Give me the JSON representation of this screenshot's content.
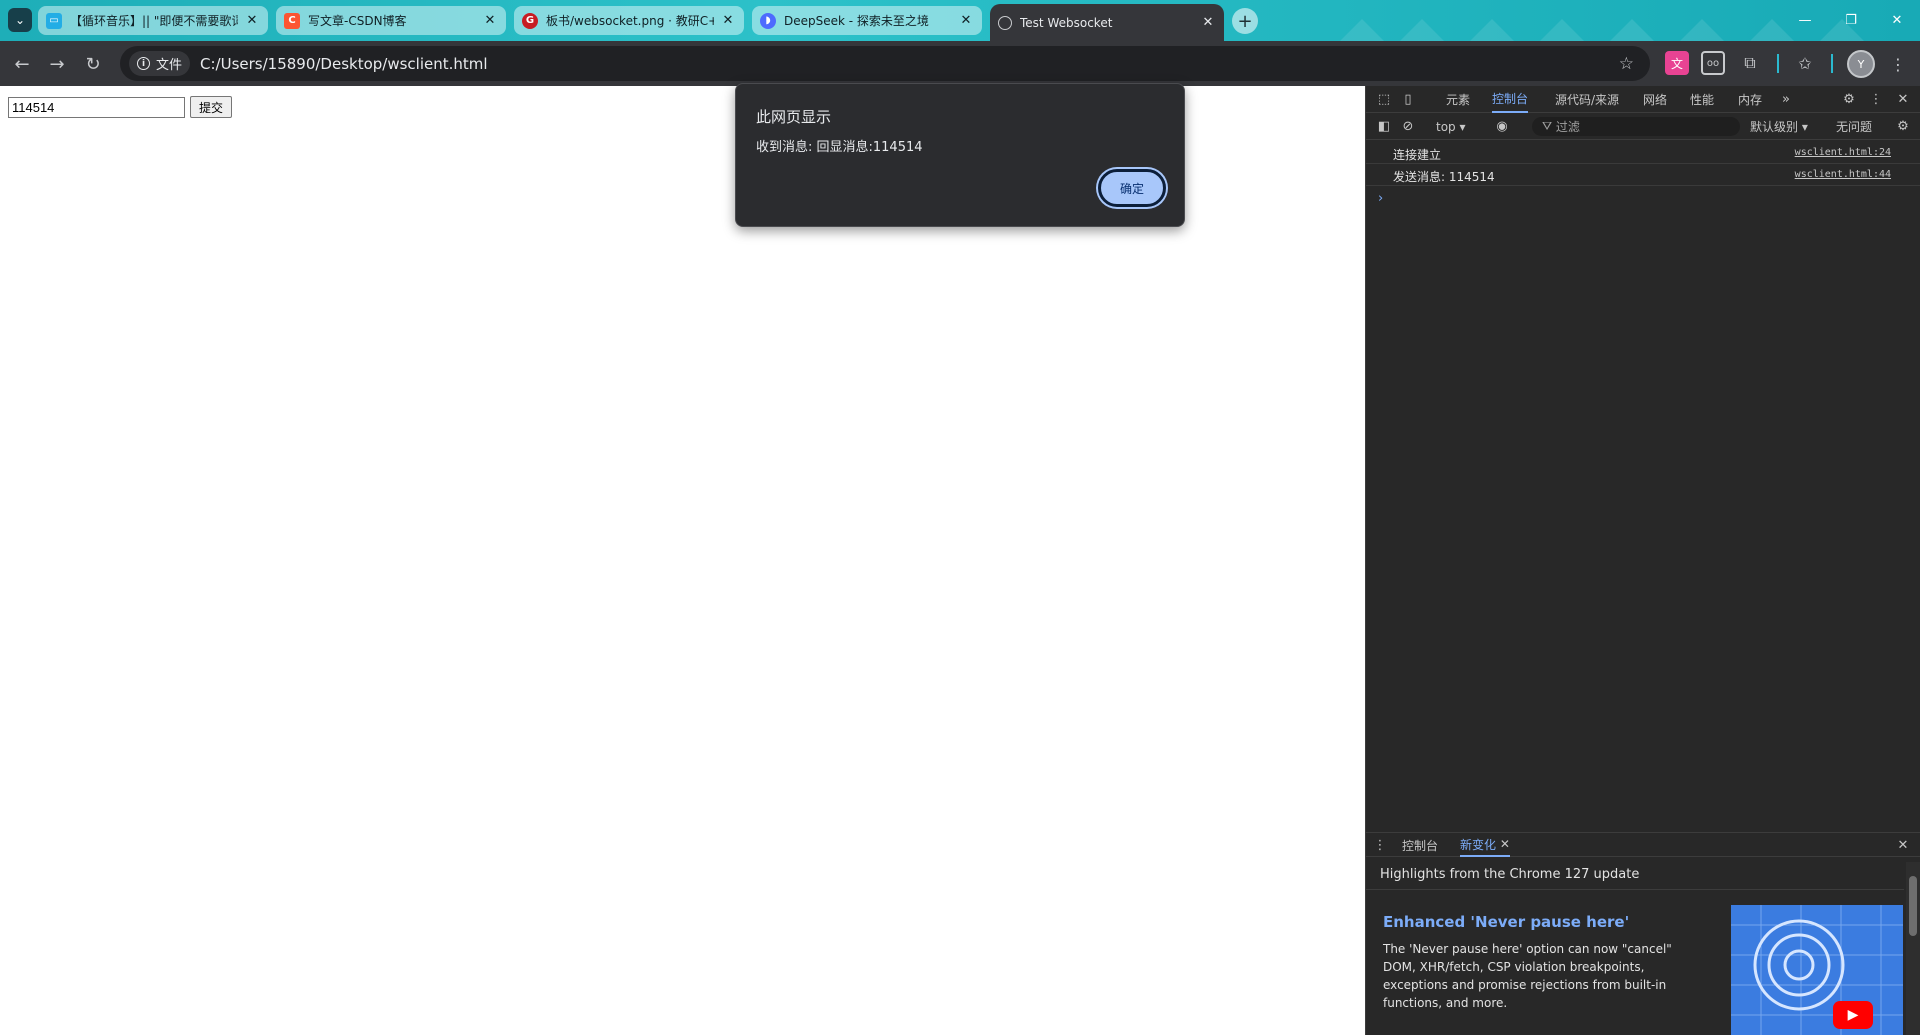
{
  "browser": {
    "tabs": [
      {
        "title": "【循环音乐】|| \"即便不需要歌词",
        "favicon": "bilibili-icon",
        "color": "#23ade5"
      },
      {
        "title": "写文章-CSDN博客",
        "favicon": "csdn-icon",
        "color": "#fc5531"
      },
      {
        "title": "板书/websocket.png · 教研C++",
        "favicon": "gitee-icon",
        "color": "#c71d23"
      },
      {
        "title": "DeepSeek - 探索未至之境",
        "favicon": "deepseek-icon",
        "color": "#4d6bfe"
      },
      {
        "title": "Test Websocket",
        "favicon": "globe-icon",
        "active": true
      }
    ],
    "address_chip": "文件",
    "url": "C:/Users/15890/Desktop/wsclient.html",
    "avatar_letter": "Y"
  },
  "page": {
    "input_value": "114514",
    "submit_label": "提交"
  },
  "alert": {
    "title": "此网页显示",
    "message": "收到消息: 回显消息:114514",
    "ok_label": "确定"
  },
  "devtools": {
    "tabs": [
      "元素",
      "控制台",
      "源代码/来源",
      "网络",
      "性能",
      "内存"
    ],
    "active_tab": "控制台",
    "context": "top",
    "filter_placeholder": "过滤",
    "levels": "默认级别",
    "issues": "无问题",
    "logs": [
      {
        "message": "连接建立",
        "source": "wsclient.html:24"
      },
      {
        "message": "发送消息: 114514",
        "source": "wsclient.html:44"
      }
    ],
    "drawer": {
      "tabs": [
        "控制台",
        "新变化"
      ],
      "active_tab": "新变化",
      "highlights": "Highlights from the Chrome 127 update",
      "feature_title": "Enhanced 'Never pause here'",
      "feature_desc": "The 'Never pause here' option can now \"cancel\" DOM, XHR/fetch, CSP violation breakpoints, exceptions and promise rejections from built-in functions, and more."
    }
  },
  "colors": {
    "tabstrip": "#1eaeb8",
    "accent_blue": "#7cacf8",
    "dialog_button": "#a8c7fa"
  }
}
